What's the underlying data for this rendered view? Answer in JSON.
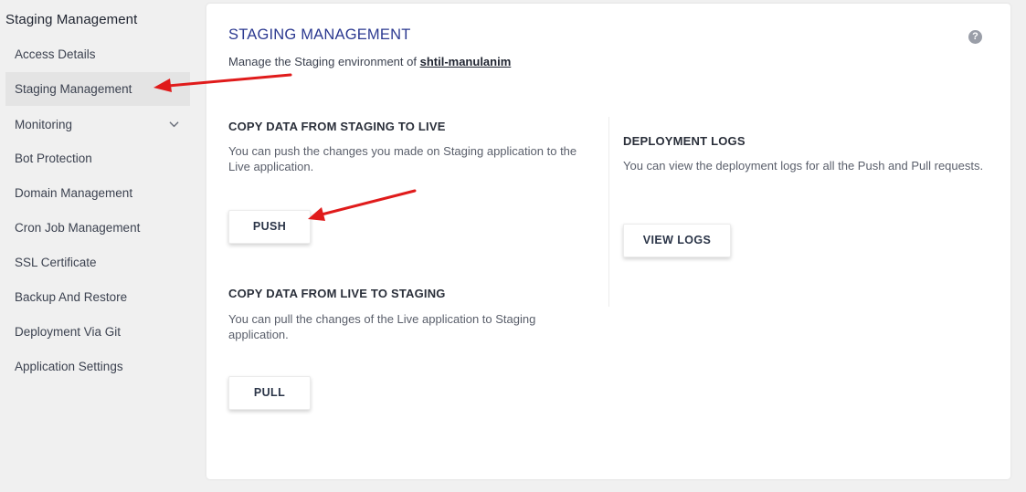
{
  "sidebar": {
    "title": "Staging Management",
    "items": [
      {
        "label": "Access Details"
      },
      {
        "label": "Staging Management"
      },
      {
        "label": "Monitoring"
      },
      {
        "label": "Bot Protection"
      },
      {
        "label": "Domain Management"
      },
      {
        "label": "Cron Job Management"
      },
      {
        "label": "SSL Certificate"
      },
      {
        "label": "Backup And Restore"
      },
      {
        "label": "Deployment Via Git"
      },
      {
        "label": "Application Settings"
      }
    ]
  },
  "main": {
    "title": "STAGING MANAGEMENT",
    "subtitle_prefix": "Manage the Staging environment of",
    "app_name": "shtil-manulanim",
    "help_glyph": "?",
    "push_section": {
      "heading": "COPY DATA FROM STAGING TO LIVE",
      "description": "You can push the changes you made on Staging application to the Live application.",
      "button_label": "PUSH"
    },
    "pull_section": {
      "heading": "COPY DATA FROM LIVE TO STAGING",
      "description": "You can pull the changes of the Live application to Staging application.",
      "button_label": "PULL"
    },
    "logs_section": {
      "heading": "DEPLOYMENT LOGS",
      "description": "You can view the deployment logs for all the Push and Pull requests.",
      "button_label": "VIEW LOGS"
    }
  },
  "colors": {
    "accent_title": "#2b3990",
    "annotation_arrow": "#e01b1b",
    "active_item_bg": "#e4e4e4"
  },
  "icons": {
    "help": "question-circle-icon",
    "monitoring_expand": "chevron-down-icon",
    "annotation": "red-arrow-icon"
  }
}
